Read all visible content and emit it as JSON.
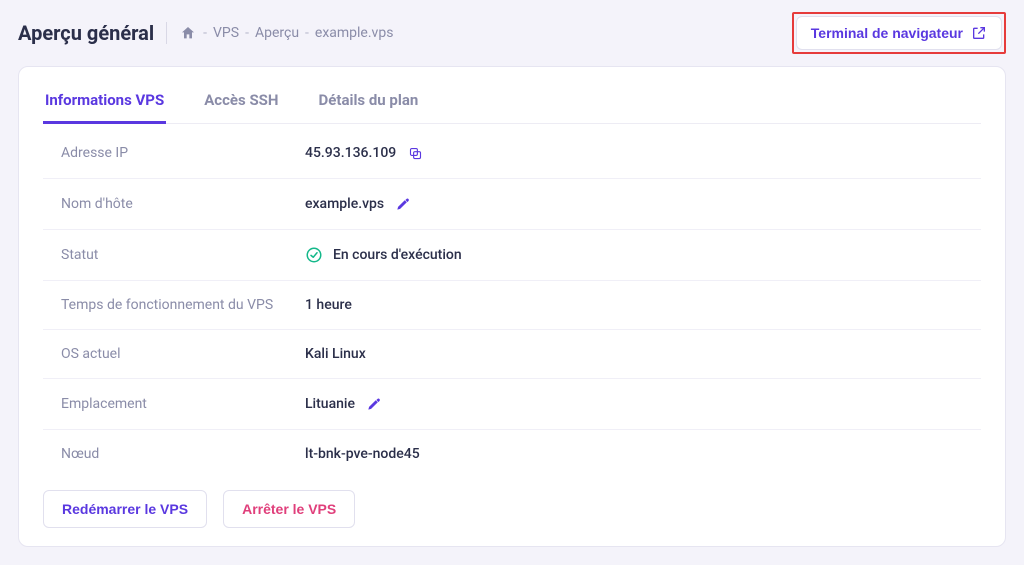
{
  "header": {
    "title": "Aperçu général",
    "breadcrumb": {
      "seg1": "VPS",
      "seg2": "Aperçu",
      "seg3": "example.vps"
    },
    "terminal_button": "Terminal de navigateur"
  },
  "tabs": {
    "info": "Informations VPS",
    "ssh": "Accès SSH",
    "plan": "Détails du plan"
  },
  "info": {
    "ip": {
      "label": "Adresse IP",
      "value": "45.93.136.109"
    },
    "hostname": {
      "label": "Nom d'hôte",
      "value": "example.vps"
    },
    "status": {
      "label": "Statut",
      "value": "En cours d'exécution"
    },
    "uptime": {
      "label": "Temps de fonctionnement du VPS",
      "value": "1 heure"
    },
    "os": {
      "label": "OS actuel",
      "value": "Kali Linux"
    },
    "location": {
      "label": "Emplacement",
      "value": "Lituanie"
    },
    "node": {
      "label": "Nœud",
      "value": "lt-bnk-pve-node45"
    }
  },
  "actions": {
    "restart": "Redémarrer le VPS",
    "stop": "Arrêter le VPS"
  }
}
